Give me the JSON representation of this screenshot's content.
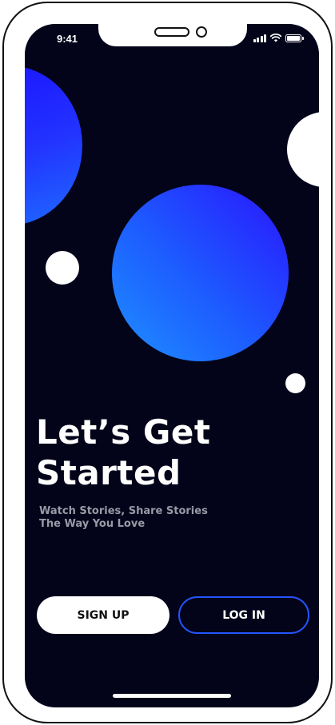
{
  "status_bar": {
    "time": "9:41"
  },
  "welcome": {
    "headline": "Let’s Get Started",
    "subtitle_line1": "Watch Stories, Share Stories",
    "subtitle_line2": "The Way You Love"
  },
  "actions": {
    "signup_label": "SIGN UP",
    "login_label": "LOG IN"
  },
  "colors": {
    "background": "#03031a",
    "accent_blue": "#2555ff",
    "text_primary": "#ffffff",
    "text_secondary": "#9a9aa6"
  },
  "icons": [
    "signal-icon",
    "wifi-icon",
    "battery-icon"
  ]
}
